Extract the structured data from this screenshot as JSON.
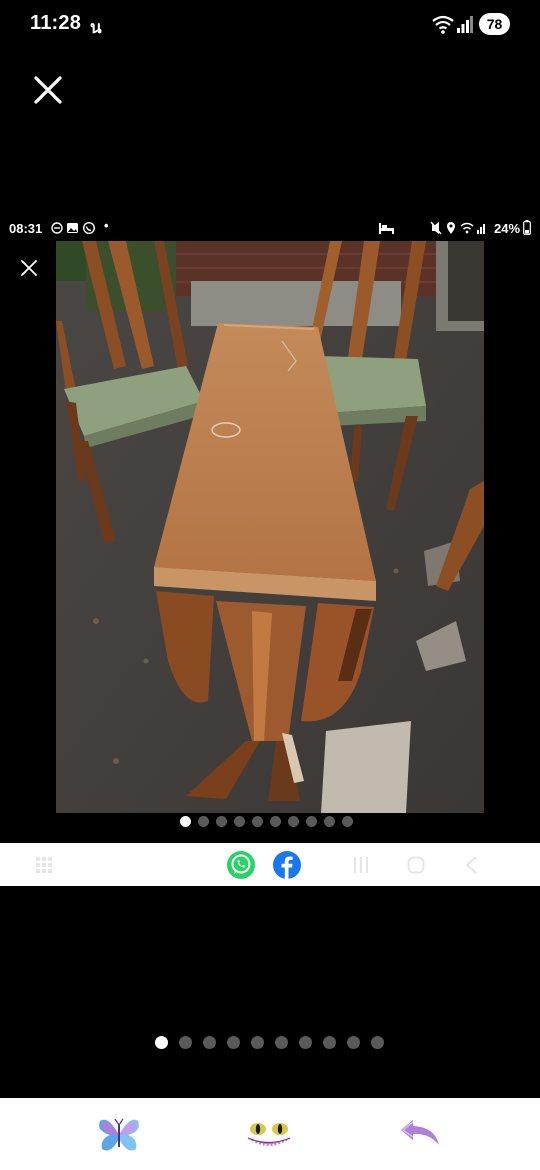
{
  "status_bar": {
    "time": "11:28",
    "notification_glyph": "น",
    "battery": "78",
    "icons": [
      "wifi-icon",
      "signal-icon"
    ]
  },
  "viewer": {
    "close_icon": "close-icon"
  },
  "inner_status_bar": {
    "time": "08:31",
    "dot": "•",
    "battery": "24%",
    "icons_left": [
      "dnd-icon",
      "gallery-icon",
      "whatsapp-icon"
    ],
    "icons_right": [
      "sleep-icon",
      "mute-icon",
      "location-icon",
      "wifi-icon",
      "signal-icon",
      "battery-icon"
    ]
  },
  "photo": {
    "subject": "drop-leaf-table-with-chairs",
    "colors": {
      "wood": "#b8784a",
      "wood_dark": "#6b3a1c",
      "seat": "#8fa07f",
      "ground": "#3d3b3a",
      "fence": "#5a3228"
    }
  },
  "inner_carousel": {
    "count": 10,
    "active": 0
  },
  "share_bar": {
    "items": [
      "recents-icon",
      "whatsapp-icon",
      "facebook-icon",
      "lines-icon",
      "home-icon",
      "back-icon"
    ],
    "colors": {
      "whatsapp": "#25d366",
      "facebook": "#1877f2"
    }
  },
  "outer_carousel": {
    "count": 10,
    "active": 0
  },
  "bottom_bar": {
    "items": [
      "butterfly-icon",
      "cat-face-icon",
      "reply-icon"
    ],
    "colors": {
      "reply": "#b07fd6"
    }
  }
}
